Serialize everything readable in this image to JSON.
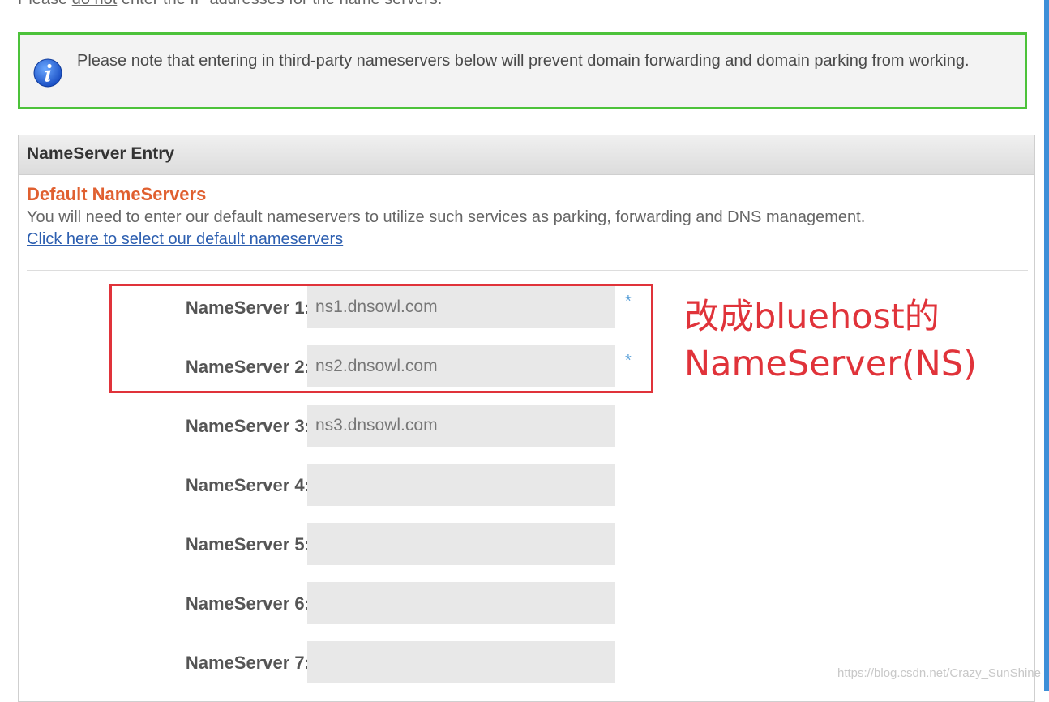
{
  "top_note": {
    "prefix": "Please ",
    "underlined": "do not",
    "suffix": " enter the IP addresses for the name servers."
  },
  "info": {
    "icon": "info-icon",
    "text": "Please note that entering in third-party nameservers below will prevent domain forwarding and domain parking from working."
  },
  "panel": {
    "header": "NameServer Entry",
    "section_title": "Default NameServers",
    "section_desc": "You will need to enter our default nameservers to utilize such services as parking, forwarding and DNS management.",
    "link": "Click here to select our default nameservers"
  },
  "nameservers": [
    {
      "label": "NameServer 1:",
      "value": "ns1.dnsowl.com",
      "required": "*"
    },
    {
      "label": "NameServer 2:",
      "value": "ns2.dnsowl.com",
      "required": "*"
    },
    {
      "label": "NameServer 3:",
      "value": "ns3.dnsowl.com"
    },
    {
      "label": "NameServer 4:",
      "value": ""
    },
    {
      "label": "NameServer 5:",
      "value": ""
    },
    {
      "label": "NameServer 6:",
      "value": ""
    },
    {
      "label": "NameServer 7:",
      "value": ""
    }
  ],
  "annotation": {
    "line1": "改成bluehost的",
    "line2": "NameServer(NS)"
  },
  "watermark": "https://blog.csdn.net/Crazy_SunShine",
  "colors": {
    "info_border": "#4cc23a",
    "annotation_red": "#e0333a",
    "section_title": "#e06030",
    "link": "#2d5fb0"
  }
}
